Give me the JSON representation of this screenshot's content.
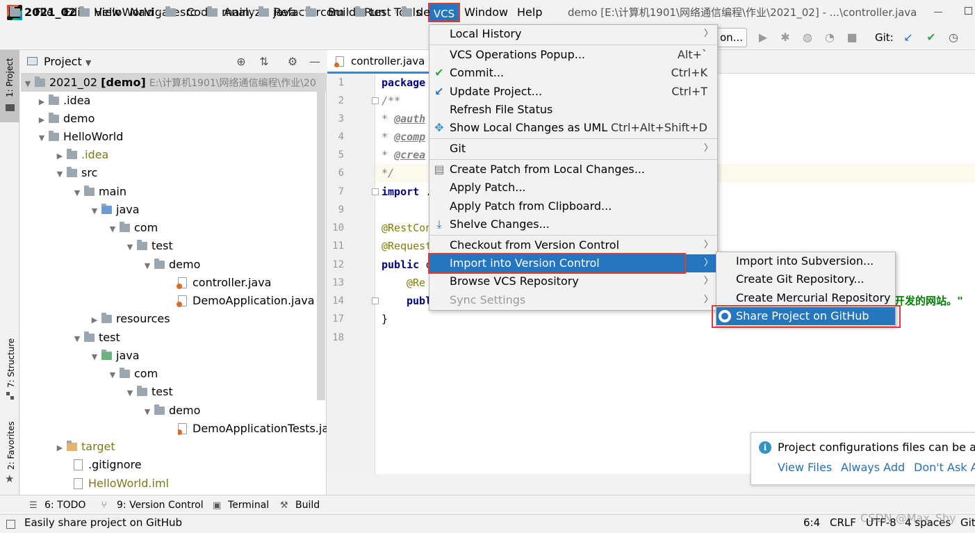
{
  "menubar": {
    "logo_text": "IJ",
    "items": [
      "File",
      "Edit",
      "View",
      "Navigate",
      "Code",
      "Analyze",
      "Refactor",
      "Build",
      "Run",
      "Tools",
      "VCS",
      "Window",
      "Help"
    ],
    "window_title": "demo [E:\\计算机1901\\网络通信编程\\作业\\2021_02] - ...\\controller.java"
  },
  "breadcrumb": [
    "2021_02",
    "HelloWorld",
    "src",
    "main",
    "java",
    "com",
    "test",
    "de"
  ],
  "toolbar": {
    "run_config": "on...",
    "git_label": "Git:"
  },
  "left_stripe": {
    "project": "1: Project",
    "structure": "7: Structure",
    "favorites": "2: Favorites"
  },
  "project_panel": {
    "title": "Project",
    "tree": [
      {
        "label": "2021_02",
        "bold": "[demo]",
        "path": "E:\\计算机1901\\网络通信编程\\作业\\202"
      },
      {
        "label": ".idea"
      },
      {
        "label": "demo"
      },
      {
        "label": "HelloWorld"
      },
      {
        "label": ".idea"
      },
      {
        "label": "src"
      },
      {
        "label": "main"
      },
      {
        "label": "java"
      },
      {
        "label": "com"
      },
      {
        "label": "test"
      },
      {
        "label": "demo"
      },
      {
        "label": "controller.java"
      },
      {
        "label": "DemoApplication.java"
      },
      {
        "label": "resources"
      },
      {
        "label": "test"
      },
      {
        "label": "java"
      },
      {
        "label": "com"
      },
      {
        "label": "test"
      },
      {
        "label": "demo"
      },
      {
        "label": "DemoApplicationTests.java"
      },
      {
        "label": "target"
      },
      {
        "label": ".gitignore"
      },
      {
        "label": "HelloWorld.iml"
      }
    ]
  },
  "editor": {
    "tab": "controller.java",
    "line_numbers": [
      "1",
      "2",
      "3",
      "4",
      "5",
      "6",
      "7",
      "9",
      "10",
      "11",
      "12",
      "13",
      "14",
      "17",
      "18"
    ],
    "code": {
      "l1": "package",
      "l2": "/**",
      "l3_star": " * ",
      "l3_tag": "@auth",
      "l4_tag": "@comp",
      "l5_tag": "@crea",
      "l6": " */",
      "l7_kw": "import",
      "l7_rest": " .",
      "l10": "@RestCon",
      "l11": "@Request",
      "l12_kw": "public",
      "l12_rest": " c",
      "l13": "@Re",
      "l14_kw": "publ",
      "l14_str": "开发的网站。\"",
      "l17": "}"
    }
  },
  "vcs_menu": {
    "items": [
      {
        "label": "Local History",
        "shortcut": "",
        "submenu": true
      },
      {
        "label": "VCS Operations Popup...",
        "shortcut": "Alt+`"
      },
      {
        "label": "Commit...",
        "shortcut": "Ctrl+K"
      },
      {
        "label": "Update Project...",
        "shortcut": "Ctrl+T"
      },
      {
        "label": "Refresh File Status",
        "shortcut": ""
      },
      {
        "label": "Show Local Changes as UML",
        "shortcut": "Ctrl+Alt+Shift+D"
      },
      {
        "label": "Git",
        "shortcut": "",
        "submenu": true
      },
      {
        "label": "Create Patch from Local Changes...",
        "shortcut": ""
      },
      {
        "label": "Apply Patch...",
        "shortcut": ""
      },
      {
        "label": "Apply Patch from Clipboard...",
        "shortcut": ""
      },
      {
        "label": "Shelve Changes...",
        "shortcut": ""
      },
      {
        "label": "Checkout from Version Control",
        "shortcut": "",
        "submenu": true
      },
      {
        "label": "Import into Version Control",
        "shortcut": "",
        "submenu": true
      },
      {
        "label": "Browse VCS Repository",
        "shortcut": "",
        "submenu": true
      },
      {
        "label": "Sync Settings",
        "shortcut": "",
        "submenu": true
      }
    ]
  },
  "import_submenu": {
    "items": [
      "Import into Subversion...",
      "Create Git Repository...",
      "Create Mercurial Repository",
      "Share Project on GitHub"
    ]
  },
  "notification": {
    "message": "Project configurations files can be adde",
    "links": [
      "View Files",
      "Always Add",
      "Don't Ask Ag"
    ]
  },
  "tool_windows": [
    "6: TODO",
    "9: Version Control",
    "Terminal",
    "Build"
  ],
  "status": {
    "text": "Easily share project on GitHub",
    "position": "6:4",
    "line_sep": "CRLF",
    "encoding": "UTF-8",
    "indent": "4 spaces",
    "vcs": "Git"
  },
  "watermark": "CSDN @Max_Shy",
  "colors": {
    "accent": "#2675bf",
    "highlight_box": "#e53935",
    "link": "#2470b3"
  }
}
